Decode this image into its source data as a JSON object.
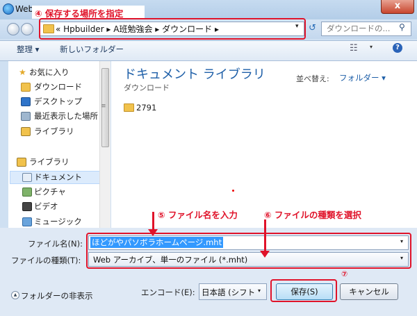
{
  "window": {
    "title": "Web",
    "close_glyph": "x"
  },
  "address": {
    "breadcrumb": "«  Hpbuilder  ▸ A班勉強会  ▸ ダウンロード  ▸",
    "dropdown_glyph": "▾",
    "refresh_glyph": "↺",
    "search_placeholder": "ダウンロードの...",
    "search_glyph": "⚲"
  },
  "toolbar": {
    "organize_label": "整理 ▾",
    "new_folder_label": "新しいフォルダー",
    "view_glyph": "☷",
    "view_dd": "▾",
    "help_glyph": "?"
  },
  "nav": {
    "items": [
      {
        "label": "お気に入り"
      },
      {
        "label": "ダウンロード"
      },
      {
        "label": "デスクトップ"
      },
      {
        "label": "最近表示した場所"
      },
      {
        "label": "ライブラリ"
      },
      {
        "label": "ライブラリ"
      },
      {
        "label": "ドキュメント"
      },
      {
        "label": "ピクチャ"
      },
      {
        "label": "ビデオ"
      },
      {
        "label": "ミュージック"
      }
    ],
    "scroll_glyph": "≡"
  },
  "main": {
    "title": "ドキュメント ライブラリ",
    "subtitle": "ダウンロード",
    "sort_label": "並べ替え:",
    "sort_value": "フォルダー ▾",
    "files": [
      {
        "name": "2791"
      }
    ]
  },
  "form": {
    "filename_label": "ファイル名(N):",
    "filename_value": "ほどがやパソボラホームページ.mht",
    "filetype_label": "ファイルの種類(T):",
    "filetype_value": "Web アーカイブ、単一のファイル (*.mht)",
    "dd_glyph": "▾",
    "hide_folders_label": "フォルダーの非表示",
    "hide_glyph": "▲",
    "encoding_label": "エンコード(E):",
    "encoding_value": "日本語 (シフト",
    "save_label": "保存(S)",
    "cancel_label": "キャンセル"
  },
  "annotations": {
    "step4": "④ 保存する場所を指定",
    "step5": "⑤ ファイル名を入力",
    "step6": "⑥ ファイルの種類を選択",
    "step7": "⑦",
    "color": "#e0132a"
  }
}
